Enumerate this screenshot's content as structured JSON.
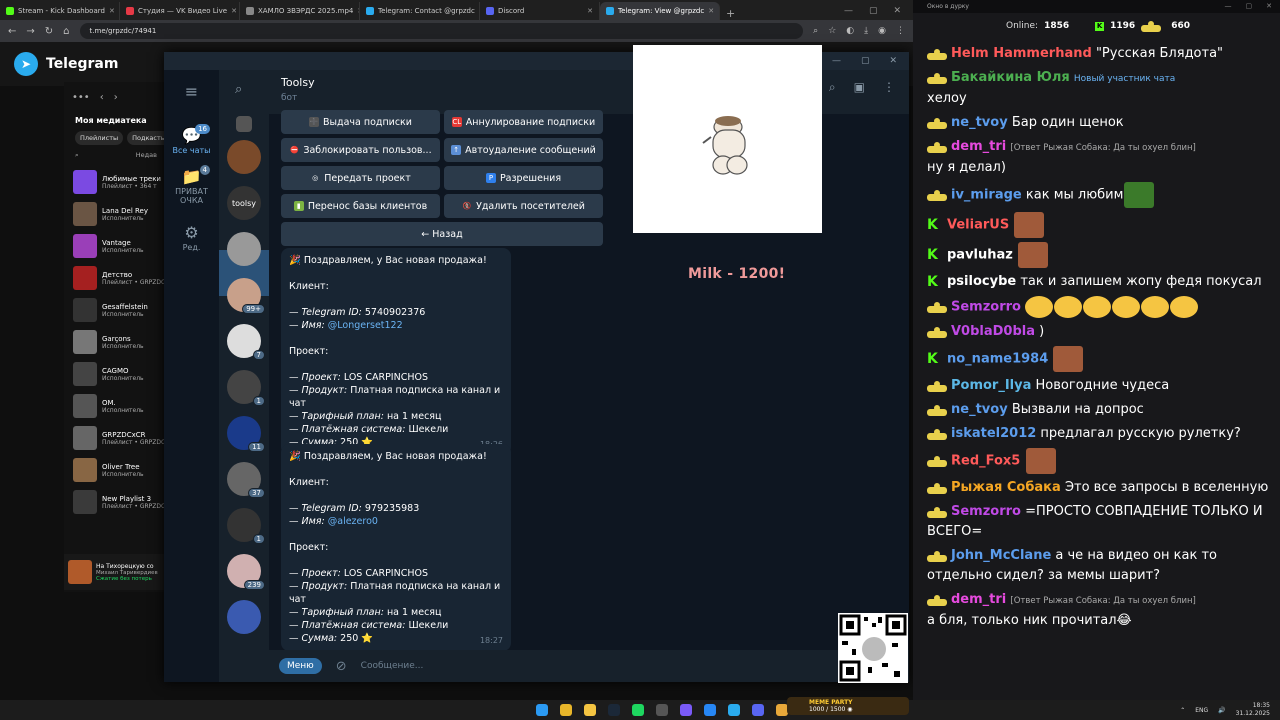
{
  "browser": {
    "tabs": [
      {
        "label": "Stream - Kick Dashboard",
        "color": "#53fc18"
      },
      {
        "label": "Студия — VK Видео Live",
        "color": "#e63946"
      },
      {
        "label": "ХАМЛО ЗВЭРДС 2025.mp4",
        "color": "#888888"
      },
      {
        "label": "Telegram: Contact @grpzdc",
        "color": "#2aabee"
      },
      {
        "label": "Discord",
        "color": "#5865f2"
      },
      {
        "label": "Telegram: View @grpzdc",
        "color": "#2aabee"
      }
    ],
    "url": "t.me/grpzdc/74941"
  },
  "tgweb": {
    "title": "Telegram"
  },
  "spotify": {
    "library_title": "Моя медиатека",
    "chips": [
      "Плейлисты",
      "Подкасты"
    ],
    "search_hint": "Недав",
    "items": [
      {
        "title": "Любимые треки",
        "sub": "Плейлист • 364 т",
        "color": "#7b4ae2"
      },
      {
        "title": "Lana Del Rey",
        "sub": "Исполнитель",
        "color": "#6a5544"
      },
      {
        "title": "Vantage",
        "sub": "Исполнитель",
        "color": "#9a3fb8"
      },
      {
        "title": "Детство",
        "sub": "Плейлист • GRPZDC",
        "color": "#a52020"
      },
      {
        "title": "Gesaffelstein",
        "sub": "Исполнитель",
        "color": "#333333"
      },
      {
        "title": "Garçons",
        "sub": "Исполнитель",
        "color": "#777777"
      },
      {
        "title": "CAGMO",
        "sub": "Исполнитель",
        "color": "#444444"
      },
      {
        "title": "OM.",
        "sub": "Исполнитель",
        "color": "#555555"
      },
      {
        "title": "GRPZDCxCR",
        "sub": "Плейлист • GRPZDC",
        "color": "#666666"
      },
      {
        "title": "Oliver Tree",
        "sub": "Исполнитель",
        "color": "#886644"
      },
      {
        "title": "New Playlist 3",
        "sub": "Плейлист • GRPZDC",
        "color": "#3a3a3a"
      }
    ],
    "now_playing": {
      "title": "На Тихорецкую со",
      "sub": "Михаил Таривердиев",
      "save": "Сжатие без потерь"
    }
  },
  "tg": {
    "folders": [
      {
        "label": "Все чаты",
        "badge": "16",
        "icon": "💬"
      },
      {
        "label": "ПРИВАТ ОЧКА",
        "badge": "4",
        "icon": "📁"
      },
      {
        "label": "Ред.",
        "badge": "",
        "icon": "⚙"
      }
    ],
    "chat_avatars": [
      {
        "badge": "",
        "color": "#555"
      },
      {
        "badge": "",
        "color": "#7a4a2a"
      },
      {
        "badge": "",
        "color": "#333",
        "text": "toolsy"
      },
      {
        "badge": "",
        "color": "#999"
      },
      {
        "badge": "99+",
        "color": "#c8a08a"
      },
      {
        "badge": "7",
        "color": "#ddd"
      },
      {
        "badge": "1",
        "color": "#444"
      },
      {
        "badge": "11",
        "color": "#1a3a8a"
      },
      {
        "badge": "37",
        "color": "#666"
      },
      {
        "badge": "1",
        "color": "#333"
      },
      {
        "badge": "239",
        "color": "#d0b0b0"
      },
      {
        "badge": "",
        "color": "#3a5ab0"
      }
    ],
    "chat_name": "Toolsy",
    "chat_sub": "бот",
    "keyboard": [
      [
        {
          "label": "Выдача подписки",
          "icon": "➕",
          "bg": "#555"
        },
        {
          "label": "Аннулирование подписки",
          "icon": "CL",
          "bg": "#e53935"
        }
      ],
      [
        {
          "label": "Заблокировать пользов...",
          "icon": "⛔",
          "bg": "transparent"
        },
        {
          "label": "Автоудаление сообщений",
          "icon": "↑",
          "bg": "#5c8fd6"
        }
      ],
      [
        {
          "label": "Передать проект",
          "icon": "◎",
          "bg": "transparent"
        },
        {
          "label": "Разрешения",
          "icon": "P",
          "bg": "#2f80ed"
        }
      ],
      [
        {
          "label": "Перенос базы клиентов",
          "icon": "▮",
          "bg": "#7cb342"
        },
        {
          "label": "Удалить посетителей",
          "icon": "🚷",
          "bg": "transparent"
        }
      ],
      [
        {
          "label": "← Назад",
          "icon": "",
          "bg": "transparent"
        }
      ]
    ],
    "messages": [
      {
        "head": "🎉 Поздравляем, у Вас новая продажа!",
        "client": "Клиент:",
        "tgid_label": "— Telegram ID:",
        "tgid": "5740902376",
        "name_label": "— Имя:",
        "name": "@Longerset122",
        "project_head": "Проект:",
        "proj_label": "— Проект:",
        "proj": "LOS CARPINCHOS",
        "prod_label": "— Продукт:",
        "prod": "Платная подписка на канал и чат",
        "plan_label": "— Тарифный план:",
        "plan": "на 1 месяц",
        "pay_label": "— Платёжная система:",
        "pay": "Шекели",
        "sum_label": "— Сумма:",
        "sum": "250 ⭐",
        "time": "18:26"
      },
      {
        "head": "🎉 Поздравляем, у Вас новая продажа!",
        "client": "Клиент:",
        "tgid_label": "— Telegram ID:",
        "tgid": "979235983",
        "name_label": "— Имя:",
        "name": "@alezero0",
        "project_head": "Проект:",
        "proj_label": "— Проект:",
        "proj": "LOS CARPINCHOS",
        "prod_label": "— Продукт:",
        "prod": "Платная подписка на канал и чат",
        "plan_label": "— Тарифный план:",
        "plan": "на 1 месяц",
        "pay_label": "— Платёжная система:",
        "pay": "Шекели",
        "sum_label": "— Сумма:",
        "sum": "250 ⭐",
        "time": "18:27"
      }
    ],
    "menu_button": "Меню",
    "input_placeholder": "Сообщение..."
  },
  "overlay": {
    "milk": "Milk - 1200!"
  },
  "sidechat": {
    "title": "Окно в дурку",
    "online_label": "Online:",
    "online": "1856",
    "kick_count": "1196",
    "vk_count": "660",
    "messages": [
      {
        "user": "Helm Hammerhand",
        "color": "#ff5a5a",
        "badge": "hb",
        "text": "\"Русская Блядота\""
      },
      {
        "user": "Бакайкина Юля",
        "color": "#4caf50",
        "badge": "hb",
        "note": "Новый участник чата",
        "text": "хелоу"
      },
      {
        "user": "ne_tvoy",
        "color": "#5c9ded",
        "badge": "hb",
        "text": "Бар один щенок"
      },
      {
        "user": "dem_tri",
        "color": "#e64ade",
        "badge": "hb",
        "reply": "[Ответ Рыжая Собака: Да ты охуел блин]",
        "text": "ну я делал)"
      },
      {
        "user": "iv_mirage",
        "color": "#5c9ded",
        "badge": "hb",
        "text": "как мы любим",
        "emote": "#3b7a2a"
      },
      {
        "user": "VeliarUS",
        "color": "#ff5a5a",
        "badge": "kk",
        "text": "",
        "emote": "#a05a3a"
      },
      {
        "user": "pavluhaz",
        "color": "#ffffff",
        "badge": "kk",
        "text": "",
        "emote": "#a05a3a"
      },
      {
        "user": "psilocybe",
        "color": "#ffffff",
        "badge": "kk",
        "text": "так и запишем жопу федя покусал"
      },
      {
        "user": "Semzorro",
        "color": "#c04ae6",
        "badge": "hb",
        "text": "",
        "smiles": 6
      },
      {
        "user": "V0blaD0bla",
        "color": "#c04ae6",
        "badge": "hb",
        "text": ")"
      },
      {
        "user": "no_name1984",
        "color": "#5c9ded",
        "badge": "kk",
        "text": "",
        "emote": "#a05a3a"
      },
      {
        "user": "Pomor_Ilya",
        "color": "#5cb8e6",
        "badge": "hb",
        "text": "Новогодние чудеса"
      },
      {
        "user": "ne_tvoy",
        "color": "#5c9ded",
        "badge": "hb",
        "text": "Вызвали на допрос"
      },
      {
        "user": "iskatel2012",
        "color": "#5c9ded",
        "badge": "hb",
        "text": "предлагал русскую рулетку?"
      },
      {
        "user": "Red_Fox5",
        "color": "#ff5a5a",
        "badge": "hb",
        "text": "",
        "emote": "#a05a3a"
      },
      {
        "user": "Рыжая Собака",
        "color": "#f5a623",
        "badge": "hb",
        "text": "Это все запросы в вселенную"
      },
      {
        "user": "Semzorro",
        "color": "#c04ae6",
        "badge": "hb",
        "text": "=ПРОСТО СОВПАДЕНИЕ ТОЛЬКО И ВСЕГО="
      },
      {
        "user": "John_McClane",
        "color": "#5c9ded",
        "badge": "hb",
        "text": "а че на видео он как то отдельно сидел? за мемы шарит?"
      },
      {
        "user": "dem_tri",
        "color": "#e64ade",
        "badge": "hb",
        "reply": "[Ответ Рыжая Собака: Да ты охуел блин]",
        "text": "а бля, только ник прочитал😂"
      }
    ]
  },
  "taskbar": {
    "meme_title": "MEME PARTY",
    "meme_progress": "1000 / 1500 ◉",
    "lang": "ENG",
    "time": "18:35",
    "date": "31.12.2025"
  }
}
